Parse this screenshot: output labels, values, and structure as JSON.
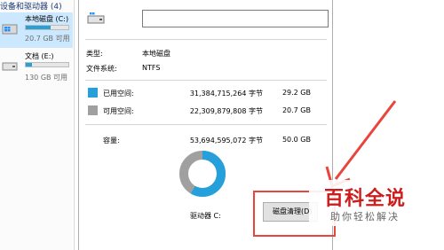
{
  "explorer": {
    "group_header": "设备和驱动器 (4)",
    "drives": [
      {
        "name": "本地磁盘 (C:)",
        "free": "20.7 GB 可用",
        "used_fraction": 0.59,
        "selected": true
      },
      {
        "name": "文档 (E:)",
        "free": "130 GB 可用",
        "used_fraction": 0.15,
        "selected": false
      }
    ]
  },
  "properties": {
    "name_value": "",
    "type_label": "类型:",
    "type_value": "本地磁盘",
    "fs_label": "文件系统:",
    "fs_value": "NTFS",
    "used_label": "已用空间:",
    "used_bytes": "31,384,715,264 字节",
    "used_gb": "29.2 GB",
    "free_label": "可用空间:",
    "free_bytes": "22,309,879,808 字节",
    "free_gb": "20.7 GB",
    "capacity_label": "容量:",
    "capacity_bytes": "53,694,595,072 字节",
    "capacity_gb": "50.0 GB",
    "drive_label": "驱动器 C:",
    "cleanup_button": "磁盘清理(D)",
    "used_fraction": 0.584,
    "colors": {
      "used": "#26a0da",
      "free": "#a0a0a0"
    }
  },
  "watermark": {
    "title": "百科全说",
    "subtitle": "助你轻松解决"
  }
}
